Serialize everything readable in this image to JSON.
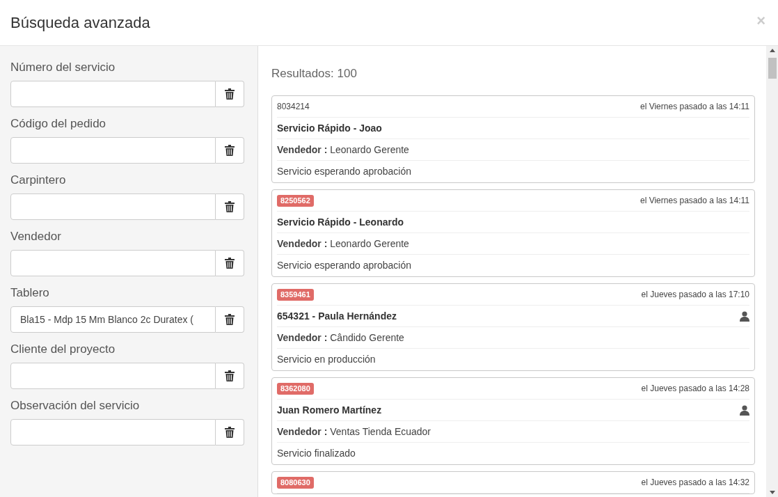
{
  "dialog": {
    "title": "Búsqueda avanzada",
    "close": "×"
  },
  "filters": [
    {
      "label": "Número del servicio"
    },
    {
      "label": "Código del pedido"
    },
    {
      "label": "Carpintero"
    },
    {
      "label": "Vendedor"
    },
    {
      "label": "Tablero",
      "value": "Bla15 - Mdp 15 Mm Blanco 2c Duratex ("
    },
    {
      "label": "Cliente del proyecto"
    },
    {
      "label": "Observación del servicio"
    }
  ],
  "results": {
    "count": "Resultados: 100",
    "cards": [
      {
        "id": "8034214",
        "flagged": false,
        "date": "el Viernes pasado a las 14:11",
        "title": "Servicio Rápido - Joao",
        "has_client": false,
        "seller_label": "Vendedor :",
        "seller": "Leonardo Gerente",
        "status": "Servicio esperando aprobación"
      },
      {
        "id": "8250562",
        "flagged": true,
        "date": "el Viernes pasado a las 14:11",
        "title": "Servicio Rápido - Leonardo",
        "has_client": false,
        "seller_label": "Vendedor :",
        "seller": "Leonardo Gerente",
        "status": "Servicio esperando aprobación"
      },
      {
        "id": "8359461",
        "flagged": true,
        "date": "el Jueves pasado a las 17:10",
        "title": "654321 - Paula Hernández",
        "has_client": true,
        "seller_label": "Vendedor :",
        "seller": "Cândido Gerente",
        "status": "Servicio en producción"
      },
      {
        "id": "8362080",
        "flagged": true,
        "date": "el Jueves pasado a las 14:28",
        "title": "Juan Romero Martínez",
        "has_client": true,
        "seller_label": "Vendedor :",
        "seller": "Ventas Tienda Ecuador",
        "status": "Servicio finalizado"
      },
      {
        "id": "8080630",
        "flagged": true,
        "date": "el Jueves pasado a las 14:32"
      }
    ]
  }
}
